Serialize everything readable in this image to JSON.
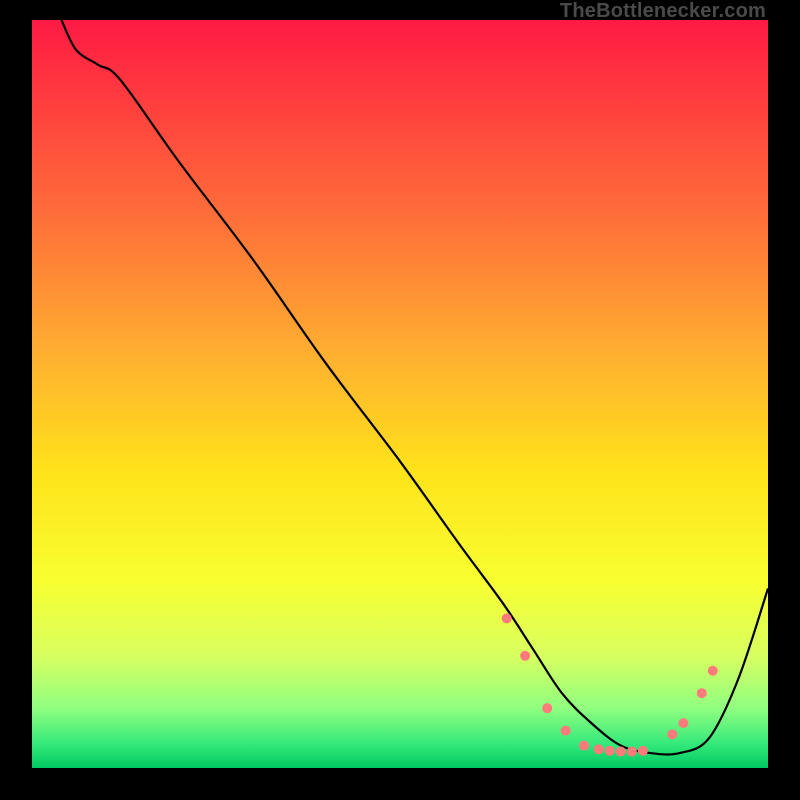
{
  "watermark": "TheBottlenecker.com",
  "chart_data": {
    "type": "line",
    "title": "",
    "xlabel": "",
    "ylabel": "",
    "xlim": [
      0,
      100
    ],
    "ylim": [
      0,
      100
    ],
    "background_gradient": {
      "stops": [
        {
          "pos": 0.0,
          "color": "#ff1a44"
        },
        {
          "pos": 0.1,
          "color": "#ff3a3f"
        },
        {
          "pos": 0.25,
          "color": "#ff6a3a"
        },
        {
          "pos": 0.45,
          "color": "#ffb030"
        },
        {
          "pos": 0.6,
          "color": "#ffe21a"
        },
        {
          "pos": 0.75,
          "color": "#f8ff30"
        },
        {
          "pos": 0.85,
          "color": "#d8ff60"
        },
        {
          "pos": 0.92,
          "color": "#90ff80"
        },
        {
          "pos": 0.97,
          "color": "#30e87a"
        },
        {
          "pos": 1.0,
          "color": "#00c860"
        }
      ]
    },
    "series": [
      {
        "name": "bottleneck-curve",
        "color": "#000000",
        "x": [
          4,
          6,
          9,
          12,
          20,
          30,
          40,
          50,
          58,
          64,
          68,
          72,
          76,
          80,
          84,
          88,
          92,
          96,
          100
        ],
        "y": [
          100,
          96,
          94,
          92,
          81,
          68,
          54,
          41,
          30,
          22,
          16,
          10,
          6,
          3,
          2,
          2,
          4,
          12,
          24
        ]
      }
    ],
    "markers": {
      "name": "reference-points",
      "color": "#ff7a7a",
      "radius": 5,
      "x": [
        64.5,
        67,
        70,
        72.5,
        75,
        77,
        78.5,
        80,
        81.5,
        83,
        87,
        88.5,
        91,
        92.5
      ],
      "y": [
        20,
        15,
        8,
        5,
        3,
        2.5,
        2.3,
        2.2,
        2.2,
        2.3,
        4.5,
        6,
        10,
        13
      ]
    }
  }
}
